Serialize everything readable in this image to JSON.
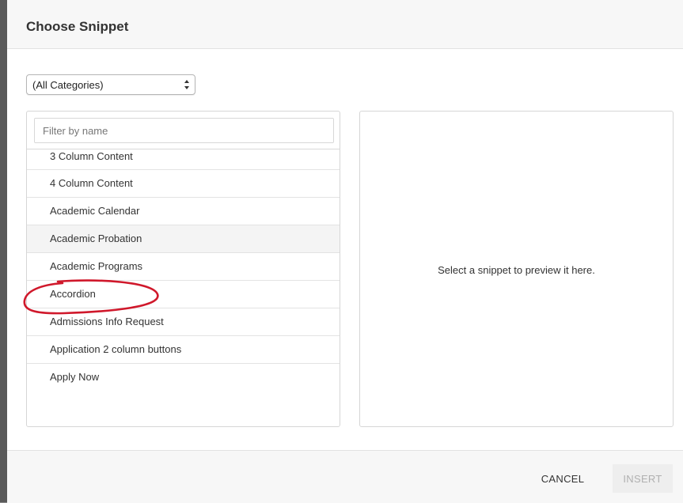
{
  "dialog": {
    "title": "Choose Snippet"
  },
  "category_select": {
    "selected": "(All Categories)"
  },
  "filter": {
    "placeholder": "Filter by name",
    "value": ""
  },
  "snippets": [
    "3 Column Content",
    "4 Column Content",
    "Academic Calendar",
    "Academic Probation",
    "Academic Programs",
    "Accordion",
    "Admissions Info Request",
    "Application 2 column buttons",
    "Apply Now"
  ],
  "hovered_index": 3,
  "preview": {
    "empty_message": "Select a snippet to preview it here."
  },
  "footer": {
    "cancel_label": "CANCEL",
    "insert_label": "INSERT"
  },
  "colors": {
    "annotation": "#d0182b",
    "insert_disabled_text": "#b0b0b0"
  },
  "icons": {
    "select_arrows": "up-down-arrows-icon",
    "annotation": "red-circle-annotation"
  }
}
